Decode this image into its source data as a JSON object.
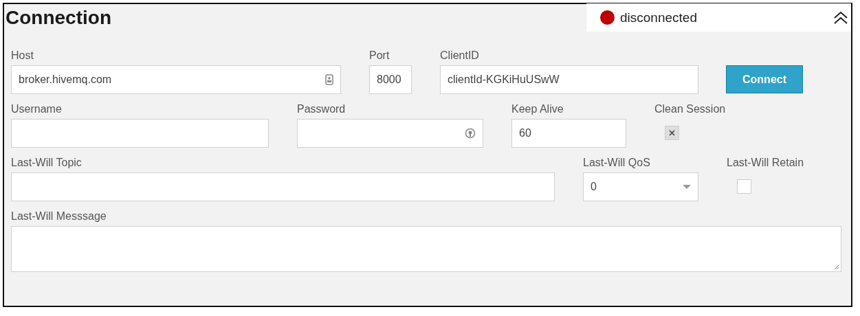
{
  "title": "Connection",
  "status": {
    "text": "disconnected",
    "connected": false
  },
  "rows": [
    [
      {
        "kind": "host",
        "label": "Host",
        "value": "broker.hivemq.com"
      },
      {
        "kind": "text",
        "label": "Port",
        "value": "8000"
      },
      {
        "kind": "text",
        "label": "ClientID",
        "value": "clientId-KGKiHuUSwW"
      },
      {
        "kind": "button",
        "text": "Connect"
      }
    ],
    [
      {
        "kind": "text",
        "label": "Username"
      },
      {
        "kind": "password",
        "label": "Password"
      },
      {
        "kind": "text",
        "label": "Keep Alive",
        "value": "60"
      },
      {
        "kind": "checkbox",
        "label": "Clean Session",
        "checked": true
      }
    ],
    [
      {
        "kind": "text",
        "label": "Last-Will Topic"
      },
      {
        "kind": "select",
        "label": "Last-Will QoS",
        "value": "0"
      },
      {
        "kind": "checkbox",
        "label": "Last-Will Retain",
        "checked": false
      }
    ],
    [
      {
        "kind": "textarea",
        "label": "Last-Will Messsage"
      }
    ]
  ]
}
